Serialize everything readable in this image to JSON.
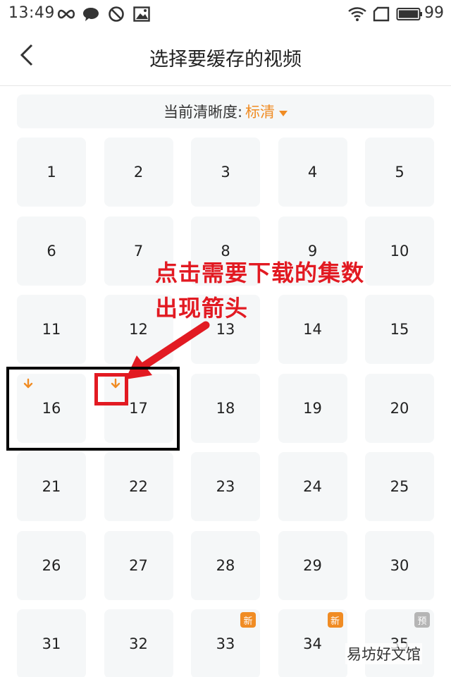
{
  "status_bar": {
    "time": "13:49",
    "battery_level": "99",
    "icons": [
      "infinity-icon",
      "chat-bubble-icon",
      "do-not-disturb-icon",
      "image-icon",
      "wifi-icon",
      "sim-card-icon",
      "battery-icon"
    ]
  },
  "nav": {
    "title": "选择要缓存的视频",
    "back_icon": "chevron-left-icon"
  },
  "quality": {
    "label": "当前清晰度:",
    "value": "标清",
    "caret_icon": "caret-down-icon",
    "accent_color": "#f08c24"
  },
  "episodes": [
    {
      "number": "1"
    },
    {
      "number": "2"
    },
    {
      "number": "3"
    },
    {
      "number": "4"
    },
    {
      "number": "5"
    },
    {
      "number": "6"
    },
    {
      "number": "7"
    },
    {
      "number": "8"
    },
    {
      "number": "9"
    },
    {
      "number": "10"
    },
    {
      "number": "11"
    },
    {
      "number": "12"
    },
    {
      "number": "13"
    },
    {
      "number": "14"
    },
    {
      "number": "15"
    },
    {
      "number": "16",
      "downloading": true
    },
    {
      "number": "17",
      "downloading": true
    },
    {
      "number": "18"
    },
    {
      "number": "19"
    },
    {
      "number": "20"
    },
    {
      "number": "21"
    },
    {
      "number": "22"
    },
    {
      "number": "23"
    },
    {
      "number": "24"
    },
    {
      "number": "25"
    },
    {
      "number": "26"
    },
    {
      "number": "27"
    },
    {
      "number": "28"
    },
    {
      "number": "29"
    },
    {
      "number": "30"
    },
    {
      "number": "31"
    },
    {
      "number": "32"
    },
    {
      "number": "33",
      "badge": "新"
    },
    {
      "number": "34",
      "badge": "新"
    },
    {
      "number": "35",
      "badge": "预"
    }
  ],
  "annotation": {
    "line1": "点击需要下载的集数",
    "line2": "出现箭头",
    "color": "#e21a22"
  },
  "watermark": "易坊好文馆"
}
